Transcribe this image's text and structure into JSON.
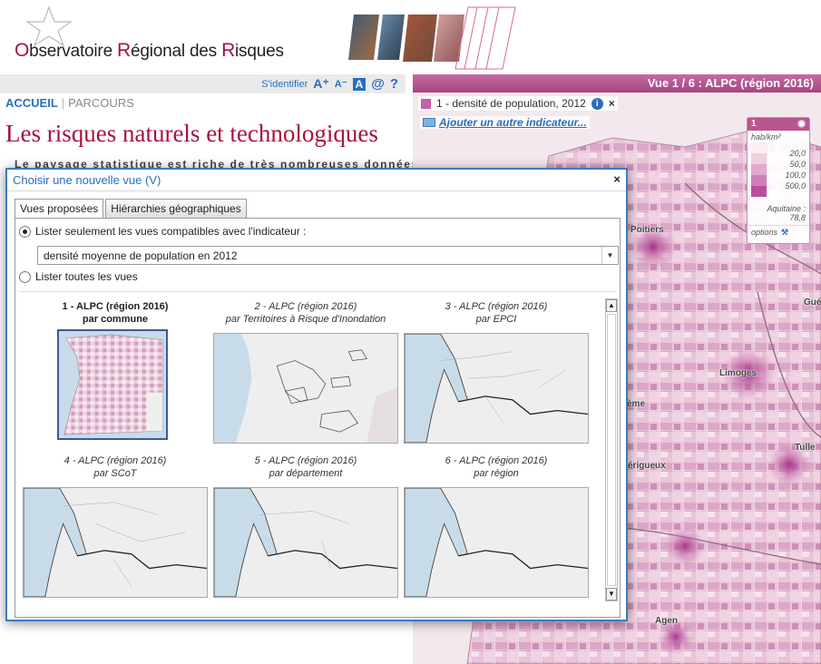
{
  "header": {
    "logo": {
      "first_letter": "O",
      "text": "bservatoire ",
      "r1": "R",
      "text2": "égional des ",
      "r2": "R",
      "text3": "isques"
    }
  },
  "toolbar": {
    "login": "S'identifier",
    "font_up": "A⁺",
    "font_down": "A⁻",
    "font_reset": "A",
    "contact": "@",
    "help": "?"
  },
  "nav": {
    "home": "ACCUEIL",
    "parcours": "PARCOURS"
  },
  "page": {
    "title": "Les risques naturels et technologiques",
    "intro": "Le paysage statistique est riche de très nombreuses données"
  },
  "map": {
    "title": "Vue 1 / 6 : ALPC (région 2016)",
    "indicator_label": "1 - densité de population, 2012",
    "add_indicator": "Ajouter un autre indicateur...",
    "legend": {
      "number": "1",
      "unit": "hab/km²",
      "classes": [
        "20,0",
        "50,0",
        "100,0",
        "500,0"
      ],
      "colors": [
        "#fbeef3",
        "#f0cfe0",
        "#e3a9cc",
        "#d07fb7",
        "#b84e9e"
      ],
      "ref_label": "Aquitaine :",
      "ref_value": "78,8",
      "options": "options"
    },
    "cities": [
      "Poitiers",
      "Limoges",
      "Tulle",
      "Agen",
      "Gué",
      "ème",
      "érigueux"
    ]
  },
  "dialog": {
    "title": "Choisir une nouvelle vue (V)",
    "close": "×",
    "tabs": [
      "Vues proposées",
      "Hiérarchies géographiques"
    ],
    "option_compatible": "Lister seulement les vues compatibles avec l'indicateur :",
    "select_value": "densité moyenne de population en 2012",
    "option_all": "Lister toutes les vues",
    "views": [
      {
        "line1": "1 - ALPC (région 2016)",
        "line2": "par commune",
        "selected": true
      },
      {
        "line1": "2 - ALPC (région 2016)",
        "line2": "par Territoires à Risque d'Inondation",
        "selected": false
      },
      {
        "line1": "3 - ALPC (région 2016)",
        "line2": "par EPCI",
        "selected": false
      },
      {
        "line1": "4 - ALPC (région 2016)",
        "line2": "par SCoT",
        "selected": false
      },
      {
        "line1": "5 - ALPC (région 2016)",
        "line2": "par département",
        "selected": false
      },
      {
        "line1": "6 - ALPC (région 2016)",
        "line2": "par région",
        "selected": false
      }
    ],
    "scroll_up": "▲",
    "scroll_down": "▼"
  }
}
